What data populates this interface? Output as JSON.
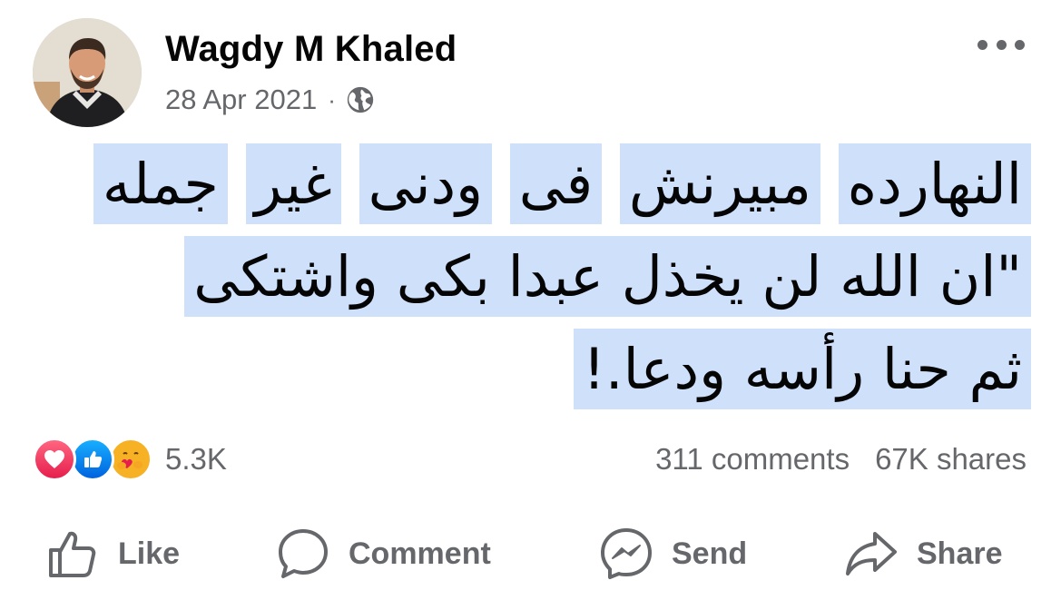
{
  "post": {
    "author_name": "Wagdy M Khaled",
    "date": "28 Apr 2021",
    "separator": "·",
    "privacy_icon": "globe-icon",
    "more_icon": "more-options-icon",
    "message_segments": [
      "النهارده",
      "مبيرنش",
      "فى",
      "ودنى",
      "غير",
      "جمله",
      "\"ان الله لن يخذل عبدا بكى واشتكى",
      "ثم حنا رأسه ودعا.!"
    ],
    "highlight_color": "#cfe0fb"
  },
  "engagement": {
    "reaction_icons": [
      "love-reaction-icon",
      "like-reaction-icon",
      "care-reaction-icon"
    ],
    "reaction_count": "5.3K",
    "comments": "311 comments",
    "shares": "67K shares"
  },
  "actions": {
    "like_label": "Like",
    "comment_label": "Comment",
    "send_label": "Send",
    "share_label": "Share"
  },
  "colors": {
    "secondary_text": "#65676b",
    "primary_text": "#050505",
    "like_blue": "#0062df",
    "love_red": "#e61e4d",
    "care_yellow": "#f7b125"
  }
}
